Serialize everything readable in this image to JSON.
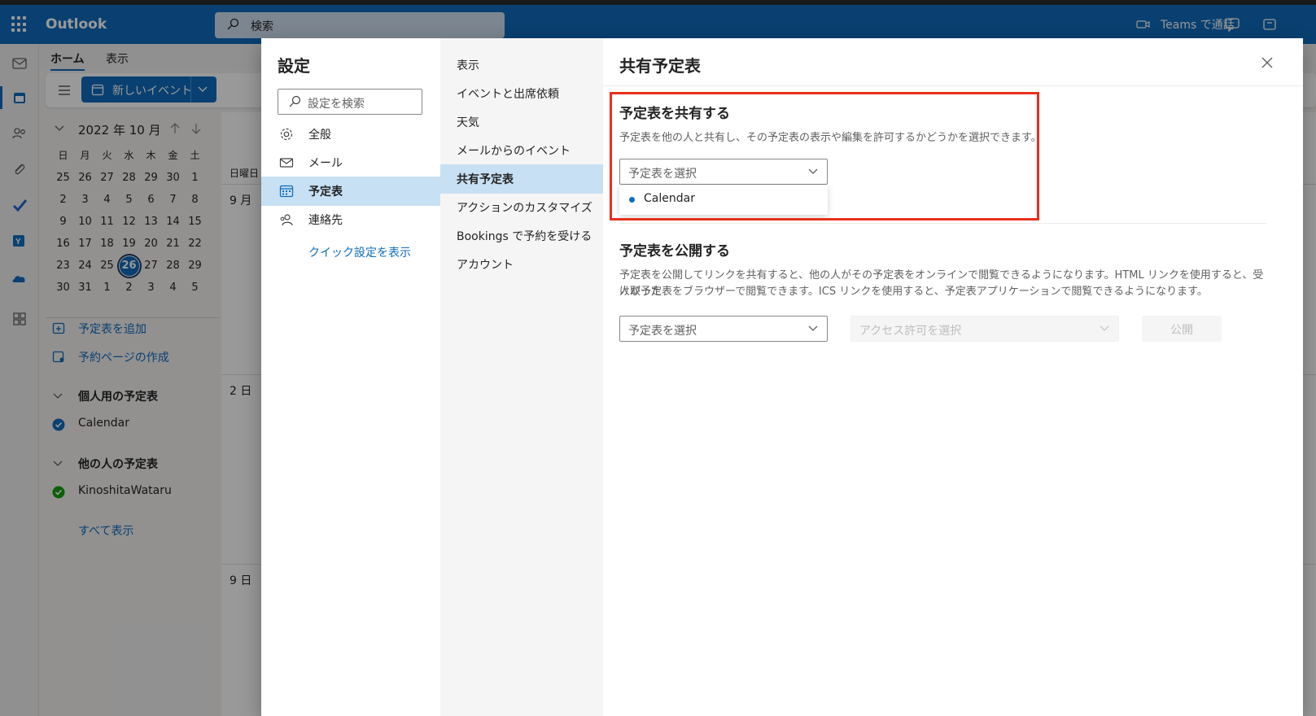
{
  "header": {
    "app_name": "Outlook",
    "search_placeholder": "検索",
    "teams_call": "Teams で通話"
  },
  "ribbon": {
    "tabs": [
      "ホーム",
      "表示"
    ],
    "new_event": "新しいイベント"
  },
  "mini_calendar": {
    "title": "2022 年 10 月",
    "weekdays": [
      "日",
      "月",
      "火",
      "水",
      "木",
      "金",
      "土"
    ],
    "weeks": [
      [
        "25",
        "26",
        "27",
        "28",
        "29",
        "30",
        "1"
      ],
      [
        "2",
        "3",
        "4",
        "5",
        "6",
        "7",
        "8"
      ],
      [
        "9",
        "10",
        "11",
        "12",
        "13",
        "14",
        "15"
      ],
      [
        "16",
        "17",
        "18",
        "19",
        "20",
        "21",
        "22"
      ],
      [
        "23",
        "24",
        "25",
        "26",
        "27",
        "28",
        "29"
      ],
      [
        "30",
        "31",
        "1",
        "2",
        "3",
        "4",
        "5"
      ]
    ],
    "today": "26"
  },
  "left_nav": {
    "add_calendar": "予定表を追加",
    "create_booking": "予約ページの作成",
    "my_calendars_header": "個人用の予定表",
    "my_calendars": [
      "Calendar"
    ],
    "other_calendars_header": "他の人の予定表",
    "other_calendars": [
      "KinoshitaWataru"
    ],
    "show_all": "すべて表示"
  },
  "calendar_view": {
    "col_header": "日曜日",
    "row_labels": [
      "9 月",
      "2 日",
      "9 日"
    ]
  },
  "settings": {
    "title": "設定",
    "search_placeholder": "設定を検索",
    "categories": [
      "全般",
      "メール",
      "予定表",
      "連絡先"
    ],
    "selected_category": "予定表",
    "quick_settings": "クイック設定を表示",
    "subcategories": [
      "表示",
      "イベントと出席依頼",
      "天気",
      "メールからのイベント",
      "共有予定表",
      "アクションのカスタマイズ",
      "Bookings で予約を受ける",
      "アカウント"
    ],
    "selected_subcategory": "共有予定表"
  },
  "panel": {
    "title": "共有予定表",
    "share": {
      "heading": "予定表を共有する",
      "description": "予定表を他の人と共有し、その予定表の表示や編集を許可するかどうかを選択できます。",
      "dropdown_placeholder": "予定表を選択",
      "dropdown_options": [
        "Calendar"
      ]
    },
    "publish": {
      "heading": "予定表を公開する",
      "description_line1": "予定表を公開してリンクを共有すると、他の人がその予定表をオンラインで閲覧できるようになります。HTML リンクを使用すると、受け取った",
      "description_line2": "人が予定表をブラウザーで閲覧できます。ICS リンクを使用すると、予定表アプリケーションで閲覧できるようになります。",
      "calendar_placeholder": "予定表を選択",
      "permission_placeholder": "アクセス許可を選択",
      "publish_button": "公開"
    }
  },
  "colors": {
    "brand": "#0f6cbd",
    "highlight": "#e8301c",
    "selected_bg": "#c7e0f4",
    "status_green": "#13a10e"
  }
}
